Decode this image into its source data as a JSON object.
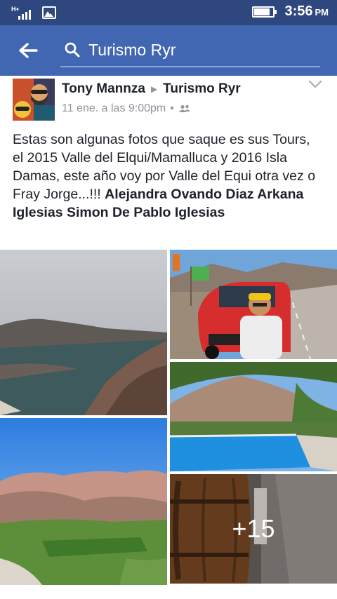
{
  "status_bar": {
    "network": "H+",
    "time": "3:56",
    "ampm": "PM",
    "battery_level": 0.85
  },
  "search": {
    "query": "Turismo Ryr"
  },
  "post": {
    "author": "Tony Mannza",
    "target": "Turismo Ryr",
    "timestamp": "11 ene. a las 9:00pm",
    "privacy": "friends-icon",
    "body": "Estas son algunas fotos que saque es sus Tours, el 2015 Valle del Elqui/Mamalluca y 2016 Isla Damas, este año voy por Valle del Equi otra vez o Fray Jorge...!!!",
    "tagged": "Alejandra Ovando Diaz Arkana Iglesias Simon De Pablo Iglesias",
    "more_photos": "+15"
  },
  "colors": {
    "status_bar": "#2f477f",
    "header": "#4267b2",
    "text": "#1d2129",
    "meta": "#90949c"
  }
}
